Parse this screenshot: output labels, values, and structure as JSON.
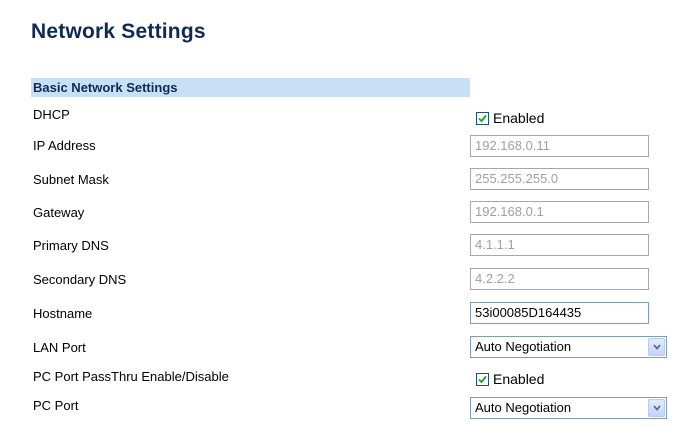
{
  "page_title": "Network Settings",
  "section_title": "Basic Network Settings",
  "fields": {
    "dhcp": {
      "label": "DHCP",
      "checked": true,
      "checkbox_label": "Enabled"
    },
    "ip_address": {
      "label": "IP Address",
      "value": "192.168.0.11"
    },
    "subnet_mask": {
      "label": "Subnet Mask",
      "value": "255.255.255.0"
    },
    "gateway": {
      "label": "Gateway",
      "value": "192.168.0.1"
    },
    "primary_dns": {
      "label": "Primary DNS",
      "value": "4.1.1.1"
    },
    "secondary_dns": {
      "label": "Secondary DNS",
      "value": "4.2.2.2"
    },
    "hostname": {
      "label": "Hostname",
      "value": "53i00085D164435"
    },
    "lan_port": {
      "label": "LAN Port",
      "selected": "Auto Negotiation"
    },
    "pc_passthru": {
      "label": "PC Port PassThru Enable/Disable",
      "checked": true,
      "checkbox_label": "Enabled"
    },
    "pc_port": {
      "label": "PC Port",
      "selected": "Auto Negotiation"
    }
  },
  "colors": {
    "title": "#0f2a55",
    "section_bg": "#c7e0f5",
    "disabled_text": "#a0a0a0"
  }
}
